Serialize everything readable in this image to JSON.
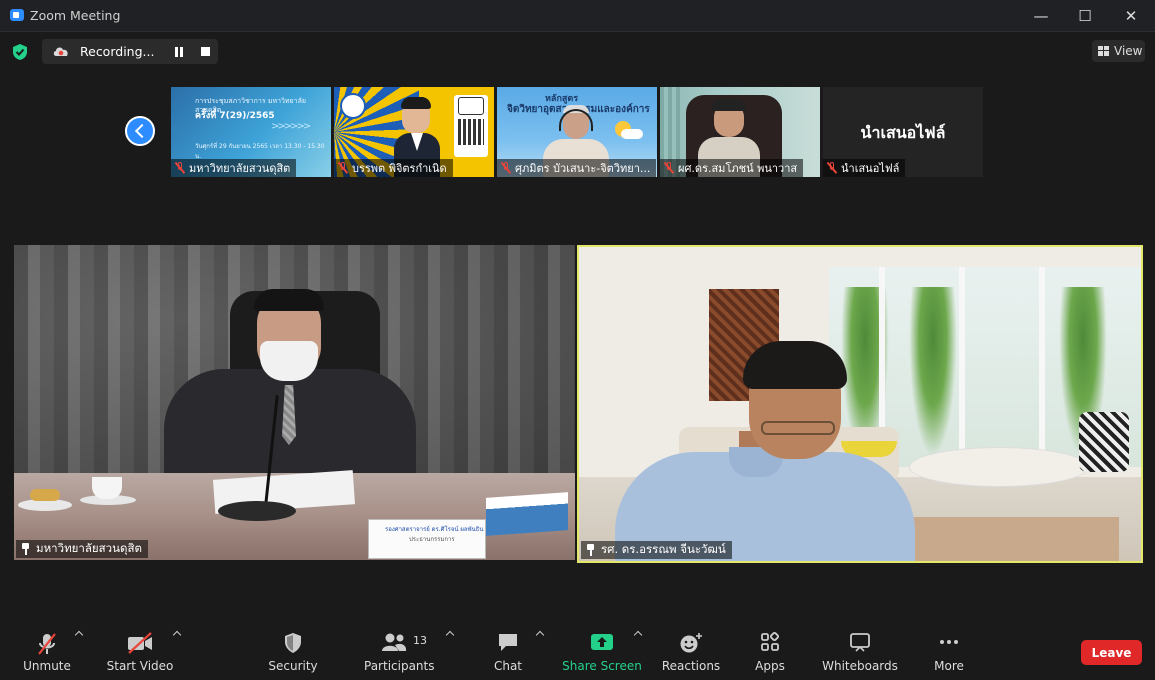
{
  "window": {
    "title": "Zoom Meeting",
    "controls": [
      "minimize",
      "maximize",
      "close"
    ]
  },
  "topbar": {
    "recording_label": "Recording...",
    "view_label": "View"
  },
  "thumbnails": [
    {
      "name": "มหาวิทยาลัยสวนดุสิต",
      "slide_title": "การประชุมสภาวิชาการ มหาวิทยาลัยสวนดุสิต",
      "slide_subtitle": "ครั้งที่ 7(29)/2565",
      "slide_date": "วันศุกร์ที่ 29 กันยายน 2565 เวลา 13.30 - 15.30 น."
    },
    {
      "name": "บรรพต พิจิตรกำเนิด"
    },
    {
      "name": "ศุภมิตร บัวเสนาะ-จิตวิทยา...",
      "headline1": "หลักสูตร",
      "headline2": "จิตวิทยาอุตสาหกรรมและองค์การ"
    },
    {
      "name": "ผศ.ดร.สมโภชน์ พนาวาส"
    },
    {
      "name": "นำเสนอไฟล์",
      "big_label": "นำเสนอไฟล์"
    }
  ],
  "main_videos": [
    {
      "name": "มหาวิทยาลัยสวนดุสิต",
      "nameplate_line1": "รองศาสตราจารย์ ดร.ศิโรจน์ ผลพันธิน",
      "nameplate_line2": "ประธานกรรมการ"
    },
    {
      "name": "รศ. ดร.อรรณพ จีนะวัฒน์",
      "active_speaker": true
    }
  ],
  "toolbar": {
    "unmute": "Unmute",
    "start_video": "Start Video",
    "security": "Security",
    "participants": "Participants",
    "participants_count": "13",
    "chat": "Chat",
    "share_screen": "Share Screen",
    "reactions": "Reactions",
    "apps": "Apps",
    "whiteboards": "Whiteboards",
    "more": "More",
    "leave": "Leave"
  },
  "colors": {
    "share_green": "#23d18b",
    "leave_red": "#e02828",
    "active_speaker_border": "#e3e86a",
    "accent_blue": "#2d8cff",
    "muted_red": "#e8443a"
  }
}
